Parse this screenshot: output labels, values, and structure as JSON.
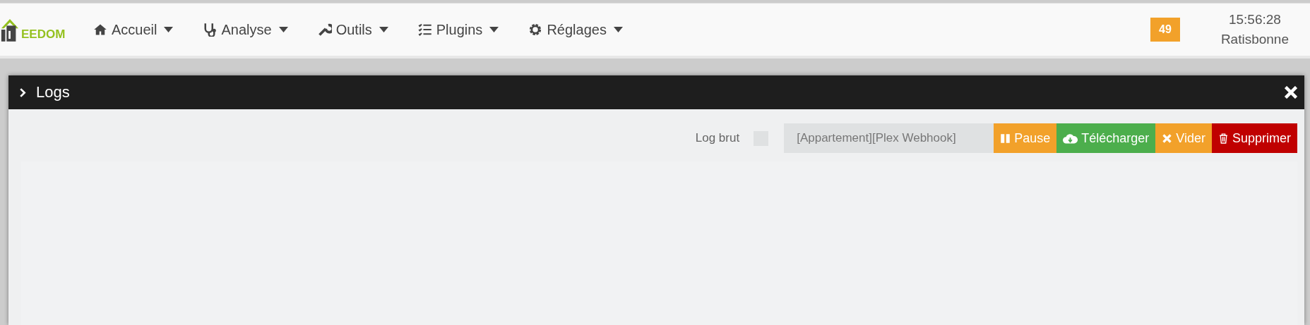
{
  "navbar": {
    "logo": "EEDOM",
    "menu": [
      {
        "label": "Accueil"
      },
      {
        "label": "Analyse"
      },
      {
        "label": "Outils"
      },
      {
        "label": "Plugins"
      },
      {
        "label": "Réglages"
      }
    ],
    "badge": "49",
    "time": "15:56:28",
    "location": "Ratisbonne"
  },
  "modal": {
    "title": "Logs",
    "log_brut": {
      "label": "Log brut",
      "checked": false
    },
    "log_select": "[Appartement][Plex Webhook]",
    "buttons": [
      {
        "label": "Pause",
        "kind": "pause"
      },
      {
        "label": "Télécharger",
        "kind": "download"
      },
      {
        "label": "Vider",
        "kind": "clear"
      },
      {
        "label": "Supprimer",
        "kind": "delete"
      }
    ]
  }
}
